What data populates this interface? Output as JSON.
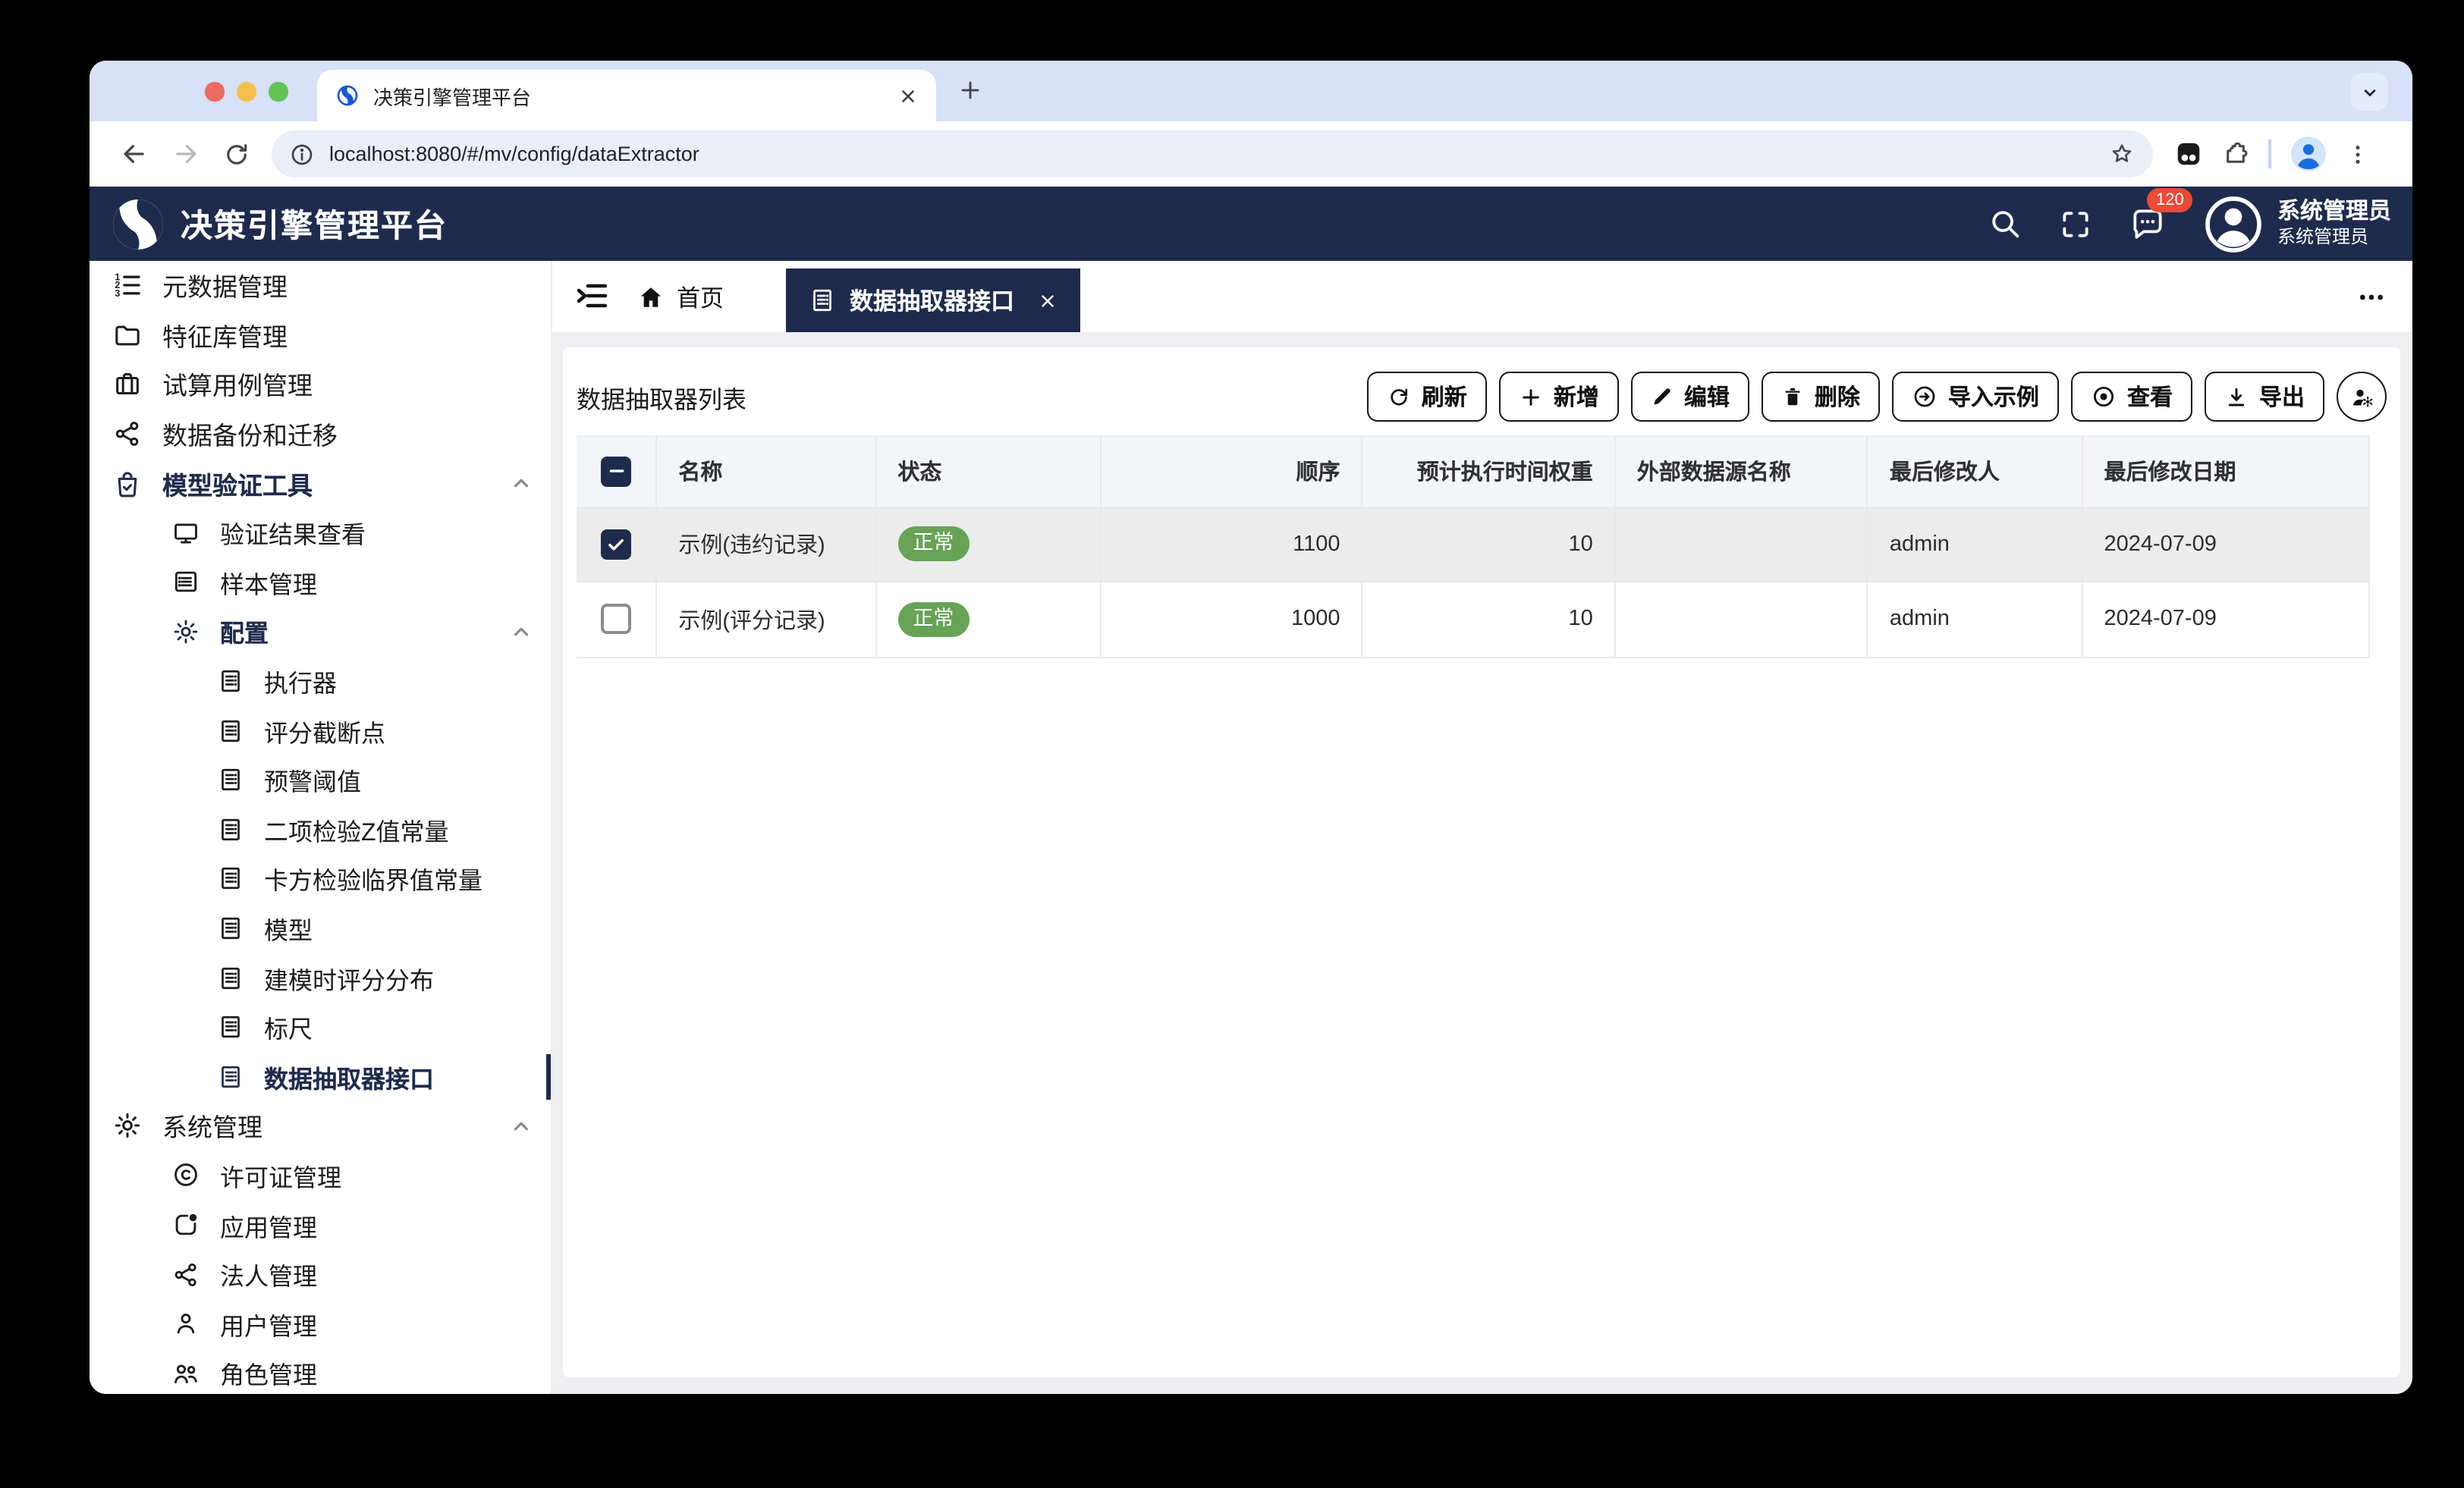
{
  "browser": {
    "tab_title": "决策引擎管理平台",
    "url": "localhost:8080/#/mv/config/dataExtractor"
  },
  "appbar": {
    "title": "决策引擎管理平台",
    "message_count": "120",
    "user_name": "系统管理员",
    "user_role": "系统管理员"
  },
  "sidebar": {
    "items": [
      {
        "label": "元数据管理"
      },
      {
        "label": "特征库管理"
      },
      {
        "label": "试算用例管理"
      },
      {
        "label": "数据备份和迁移"
      },
      {
        "label": "模型验证工具"
      },
      {
        "label": "验证结果查看"
      },
      {
        "label": "样本管理"
      },
      {
        "label": "配置"
      },
      {
        "label": "执行器"
      },
      {
        "label": "评分截断点"
      },
      {
        "label": "预警阈值"
      },
      {
        "label": "二项检验Z值常量"
      },
      {
        "label": "卡方检验临界值常量"
      },
      {
        "label": "模型"
      },
      {
        "label": "建模时评分分布"
      },
      {
        "label": "标尺"
      },
      {
        "label": "数据抽取器接口"
      },
      {
        "label": "系统管理"
      },
      {
        "label": "许可证管理"
      },
      {
        "label": "应用管理"
      },
      {
        "label": "法人管理"
      },
      {
        "label": "用户管理"
      },
      {
        "label": "角色管理"
      }
    ]
  },
  "workspace": {
    "home_tab": "首页",
    "active_tab": "数据抽取器接口"
  },
  "page": {
    "list_title": "数据抽取器列表"
  },
  "toolbar": {
    "refresh": "刷新",
    "add": "新增",
    "edit": "编辑",
    "delete": "删除",
    "import_sample": "导入示例",
    "view": "查看",
    "export": "导出"
  },
  "table": {
    "headers": [
      "名称",
      "状态",
      "顺序",
      "预计执行时间权重",
      "外部数据源名称",
      "最后修改人",
      "最后修改日期"
    ],
    "rows": [
      {
        "name": "示例(违约记录)",
        "status": "正常",
        "order": "1100",
        "weight": "10",
        "datasource": "",
        "modified_by": "admin",
        "modified_date": "2024-07-09"
      },
      {
        "name": "示例(评分记录)",
        "status": "正常",
        "order": "1000",
        "weight": "10",
        "datasource": "",
        "modified_by": "admin",
        "modified_date": "2024-07-09"
      }
    ]
  },
  "colors": {
    "navy": "#1e2b4d",
    "green": "#67a355",
    "red": "#e94b35"
  }
}
